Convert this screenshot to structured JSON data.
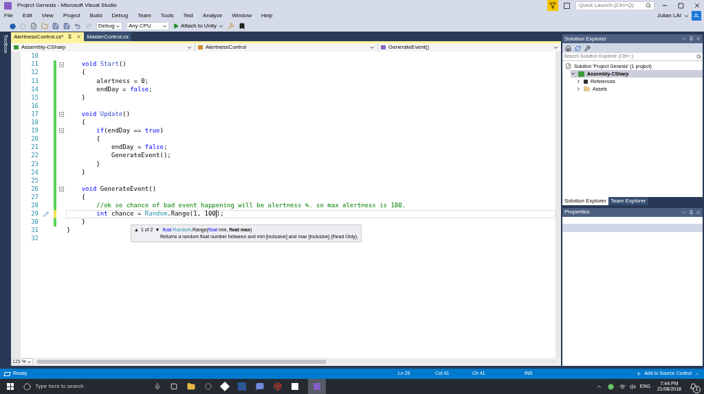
{
  "window": {
    "title": "Project Genesis - Microsoft Visual Studio",
    "quick_launch": {
      "placeholder": "Quick Launch (Ctrl+Q)"
    },
    "user": "Julian LAI",
    "avatar": "JL"
  },
  "menu": [
    "File",
    "Edit",
    "View",
    "Project",
    "Build",
    "Debug",
    "Team",
    "Tools",
    "Test",
    "Analyze",
    "Window",
    "Help"
  ],
  "toolbar": {
    "configuration": "Debug",
    "platform": "Any CPU",
    "run": "Attach to Unity"
  },
  "toolbox": {
    "label": "Toolbox"
  },
  "document_tabs": [
    {
      "label": "AlertnessControl.cs*",
      "selected": true
    },
    {
      "label": "MasterControl.cs",
      "selected": false
    }
  ],
  "navigation": {
    "project": "Assembly-CSharp",
    "type": "AlertnessControl",
    "member": "GenerateEvent()"
  },
  "code_lines": [
    {
      "number": "10",
      "changed": false,
      "current": false,
      "foldable": false
    },
    {
      "number": "11",
      "changed": true,
      "unsaved": false,
      "current": false,
      "foldable": true,
      "tokens": [
        {
          "kind": "keyword",
          "text": "    void"
        },
        {
          "kind": "method",
          "text": " Start"
        },
        {
          "kind": "plain",
          "text": "()"
        }
      ]
    },
    {
      "number": "12",
      "changed": true,
      "unsaved": false,
      "current": false,
      "foldable": false,
      "tokens": [
        {
          "kind": "plain",
          "text": "    {"
        }
      ]
    },
    {
      "number": "13",
      "changed": true,
      "unsaved": false,
      "current": false,
      "foldable": false,
      "tokens": [
        {
          "kind": "plain",
          "text": "        alertness = 0;"
        }
      ]
    },
    {
      "number": "14",
      "changed": true,
      "unsaved": false,
      "current": false,
      "foldable": false,
      "tokens": [
        {
          "kind": "plain",
          "text": "        endDay = "
        },
        {
          "kind": "keyword",
          "text": "false"
        },
        {
          "kind": "plain",
          "text": ";"
        }
      ]
    },
    {
      "number": "15",
      "changed": true,
      "unsaved": false,
      "current": false,
      "foldable": false,
      "tokens": [
        {
          "kind": "plain",
          "text": "    }"
        }
      ]
    },
    {
      "number": "16",
      "changed": true,
      "unsaved": false,
      "current": false,
      "foldable": false
    },
    {
      "number": "17",
      "changed": true,
      "unsaved": false,
      "current": false,
      "foldable": true,
      "tokens": [
        {
          "kind": "keyword",
          "text": "    void"
        },
        {
          "kind": "method",
          "text": " Update"
        },
        {
          "kind": "plain",
          "text": "()"
        }
      ]
    },
    {
      "number": "18",
      "changed": true,
      "unsaved": false,
      "current": false,
      "foldable": false,
      "tokens": [
        {
          "kind": "plain",
          "text": "    {"
        }
      ]
    },
    {
      "number": "19",
      "changed": true,
      "unsaved": false,
      "current": false,
      "foldable": true,
      "tokens": [
        {
          "kind": "keyword",
          "text": "        if"
        },
        {
          "kind": "plain",
          "text": "(endDay == "
        },
        {
          "kind": "keyword",
          "text": "true"
        },
        {
          "kind": "plain",
          "text": ")"
        }
      ]
    },
    {
      "number": "20",
      "changed": true,
      "unsaved": false,
      "current": false,
      "foldable": false,
      "tokens": [
        {
          "kind": "plain",
          "text": "        {"
        }
      ]
    },
    {
      "number": "21",
      "changed": true,
      "unsaved": false,
      "current": false,
      "foldable": false,
      "tokens": [
        {
          "kind": "plain",
          "text": "            endDay = "
        },
        {
          "kind": "keyword",
          "text": "false"
        },
        {
          "kind": "plain",
          "text": ";"
        }
      ]
    },
    {
      "number": "22",
      "changed": true,
      "unsaved": false,
      "current": false,
      "foldable": false,
      "tokens": [
        {
          "kind": "plain",
          "text": "            GenerateEvent();"
        }
      ]
    },
    {
      "number": "23",
      "changed": true,
      "unsaved": false,
      "current": false,
      "foldable": false,
      "tokens": [
        {
          "kind": "plain",
          "text": "        }"
        }
      ]
    },
    {
      "number": "24",
      "changed": true,
      "unsaved": false,
      "current": false,
      "foldable": false,
      "tokens": [
        {
          "kind": "plain",
          "text": "    }"
        }
      ]
    },
    {
      "number": "25",
      "changed": true,
      "unsaved": false,
      "current": false,
      "foldable": false
    },
    {
      "number": "26",
      "changed": true,
      "unsaved": false,
      "current": false,
      "foldable": true,
      "tokens": [
        {
          "kind": "keyword",
          "text": "    void"
        },
        {
          "kind": "plain",
          "text": " GenerateEvent()"
        }
      ]
    },
    {
      "number": "27",
      "changed": true,
      "unsaved": false,
      "current": false,
      "foldable": false,
      "tokens": [
        {
          "kind": "plain",
          "text": "    {"
        }
      ]
    },
    {
      "number": "28",
      "changed": true,
      "unsaved": false,
      "current": false,
      "foldable": false,
      "tokens": [
        {
          "kind": "comment",
          "text": "        //ok so chance of bad event happening will be alertness %. so max alertness is 100."
        }
      ]
    },
    {
      "number": "29",
      "changed": true,
      "unsaved": true,
      "current": true,
      "foldable": false,
      "tokens": [
        {
          "kind": "keyword",
          "text": "        int"
        },
        {
          "kind": "plain",
          "text": " chance = "
        },
        {
          "kind": "type",
          "text": "Random"
        },
        {
          "kind": "plain",
          "text": ".Range(1, 100"
        },
        {
          "kind": "caret"
        },
        {
          "kind": "plain",
          "text": ");"
        }
      ]
    },
    {
      "number": "30",
      "changed": true,
      "unsaved": false,
      "current": false,
      "foldable": false,
      "tokens": [
        {
          "kind": "plain",
          "text": "    }"
        }
      ]
    },
    {
      "number": "31",
      "changed": false,
      "current": false,
      "foldable": false,
      "tokens": [
        {
          "kind": "plain",
          "text": "}"
        }
      ]
    },
    {
      "number": "32",
      "changed": false,
      "current": false,
      "foldable": false
    }
  ],
  "tooltip": {
    "up": "▲",
    "counter": "1 of 2",
    "down": "▼",
    "signature": [
      {
        "kind": "keyword",
        "text": "float"
      },
      {
        "kind": "type",
        "text": " Random"
      },
      {
        "kind": "plain",
        "text": ".Range("
      },
      {
        "kind": "keyword",
        "text": "float"
      },
      {
        "kind": "plain",
        "text": " min, "
      },
      {
        "kind": "bold",
        "text": "float max"
      },
      {
        "kind": "plain",
        "text": ")"
      }
    ],
    "description": "Returns a random float number between and min [inclusive] and max [inclusive] (Read Only)."
  },
  "zoom": "123 %",
  "solution_explorer": {
    "title": "Solution Explorer",
    "search": {
      "placeholder": "Search Solution Explorer (Ctrl+;)"
    },
    "tree": [
      {
        "label": "Solution 'Project Genesis' (1 project)",
        "kind": "solution",
        "selected": false,
        "children": [
          {
            "label": "Assembly-CSharp",
            "kind": "project",
            "selected": true,
            "expanded": true,
            "children": [
              {
                "label": "References",
                "kind": "references",
                "selected": false,
                "expanded": false
              },
              {
                "label": "Assets",
                "kind": "folder",
                "selected": false,
                "expanded": false
              }
            ]
          }
        ]
      }
    ],
    "tabs": [
      {
        "label": "Solution Explorer",
        "selected": true
      },
      {
        "label": "Team Explorer",
        "selected": false
      }
    ]
  },
  "properties": {
    "title": "Properties"
  },
  "status_bar": {
    "state": "Ready",
    "line": "Ln 29",
    "column": "Col 41",
    "char": "Ch 41",
    "mode": "INS",
    "source_control": "Add to Source Control"
  },
  "taskbar": {
    "search": {
      "placeholder": "Type here to search"
    },
    "language": "ENG",
    "time": "7:44 PM",
    "date": "21/08/2018",
    "notifications": "1"
  }
}
